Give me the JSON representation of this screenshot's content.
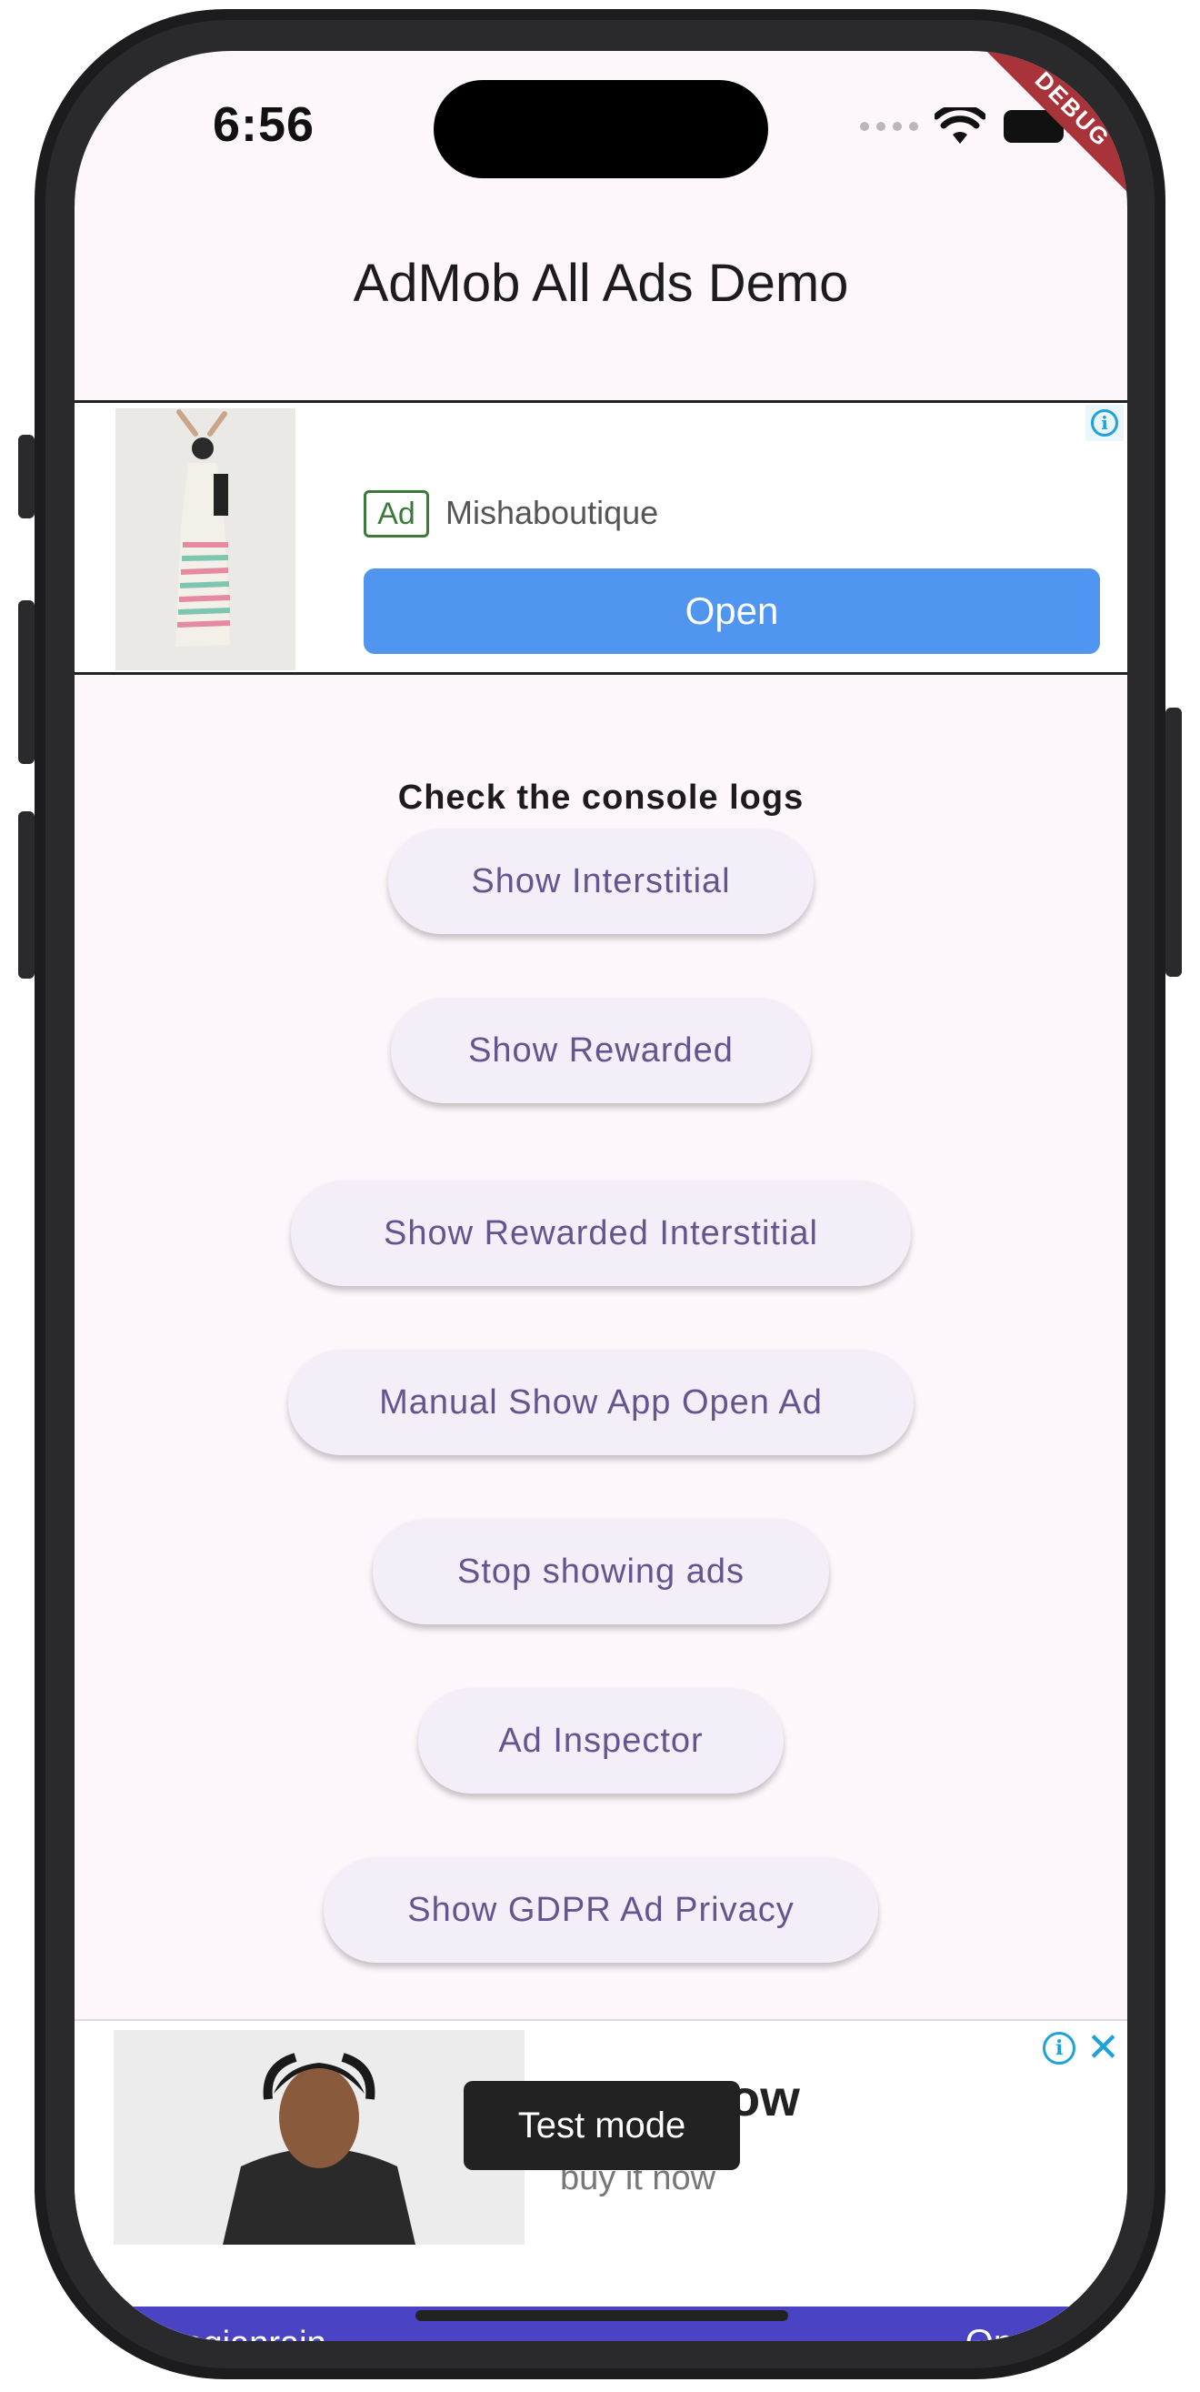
{
  "status_bar": {
    "time": "6:56",
    "debug_banner": "DEBUG"
  },
  "app_bar": {
    "title": "AdMob All Ads Demo"
  },
  "top_ad": {
    "badge": "Ad",
    "advertiser": "Mishaboutique",
    "cta": "Open",
    "info_icon": "info-icon"
  },
  "main": {
    "label": "Check the console logs",
    "buttons": [
      "Show Interstitial",
      "Show Rewarded",
      "Show Rewarded Interstitial",
      "Manual Show App Open Ad",
      "Stop showing ads",
      "Ad Inspector",
      "Show GDPR Ad Privacy"
    ]
  },
  "bottom_ad": {
    "headline": "ow",
    "subtext": "buy it now",
    "toast": "Test mode",
    "advertiser": "norwegianrain",
    "cta": "Open ›"
  },
  "colors": {
    "screen_bg": "#fdf7fb",
    "button_bg": "#f4eef9",
    "button_text": "#65558f",
    "ad_cta": "#5096f0",
    "bottom_bar": "#4a44c4",
    "debug_banner": "#a8343a"
  }
}
